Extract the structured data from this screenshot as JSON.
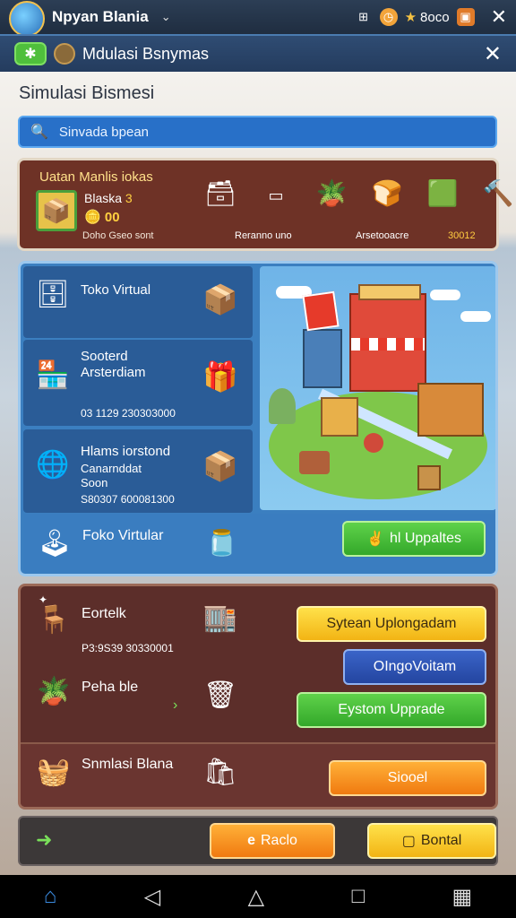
{
  "top_bar": {
    "title": "Npyan Blania",
    "coins": "8oco"
  },
  "header": {
    "title": "Mdulasi Bsnymas"
  },
  "page_title": "Simulasi Bismesi",
  "search": {
    "placeholder": "Sinvada bpean"
  },
  "resources": {
    "title": "Uatan Manlis iokas",
    "name": "Blaska",
    "name_badge": "3",
    "gold": "00",
    "sub": "Doho Gseo sont",
    "label_2": "Reranno uno",
    "label_3": "Arsetooacre",
    "label_4": "30012"
  },
  "shop_cards": [
    {
      "label": "Toko Virtual",
      "label2": "",
      "num": ""
    },
    {
      "label": "Sooterd",
      "label2": "Arsterdiam",
      "num": "03 1129 230303000"
    },
    {
      "label": "Hlams iorstond",
      "label2": "Canarnddat",
      "label3": "Soon",
      "num": "S80307 600081300"
    }
  ],
  "bottom_card": {
    "label": "Foko Virtular"
  },
  "upgrade_button": "hl Uppaltes",
  "lower": {
    "row1_label": "Eortelk",
    "row1_num": "P3:9S39 30330001",
    "row2_label": "Peha ble",
    "row3_label": "Snmlasi Blana",
    "btn_yellow": "Sytean Uplongadam",
    "btn_blue": "OIngoVoitam",
    "btn_green": "Eystom Upprade",
    "btn_orange": "Siooel"
  },
  "footer": {
    "btn_orange": "Raclo",
    "btn_yellow": "Bontal"
  },
  "colors": {
    "accent_green": "#4fbf3c",
    "accent_blue": "#2870c8",
    "panel_brown": "#6e3226"
  }
}
